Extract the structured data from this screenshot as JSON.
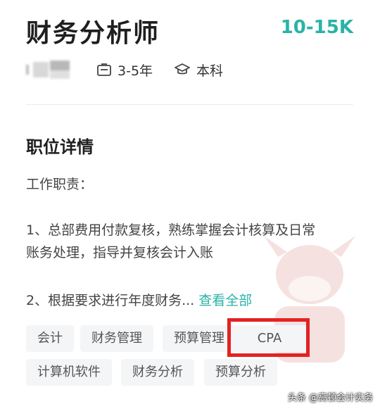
{
  "job": {
    "title": "财务分析师",
    "salary": "10-15K",
    "experience": "3-5年",
    "education": "本科"
  },
  "details": {
    "section_title": "职位详情",
    "head": "工作职责：",
    "line1": "1、总部费用付款复核，熟练掌握会计核算及日常",
    "line2": "账务处理，指导并复核会计入账",
    "line3": "2、根据要求进行年度财务...",
    "view_all": "查看全部"
  },
  "tags": [
    "会计",
    "财务管理",
    "预算管理",
    "CPA",
    "计算机软件",
    "财务分析",
    "预算分析"
  ],
  "watermark": "头条 @高顿会计实务",
  "colors": {
    "accent": "#2ab3a6",
    "highlight": "#e32222",
    "tag_bg": "#f4f5f7"
  },
  "icons": {
    "experience": "briefcase-icon",
    "education": "graduation-cap-icon"
  }
}
